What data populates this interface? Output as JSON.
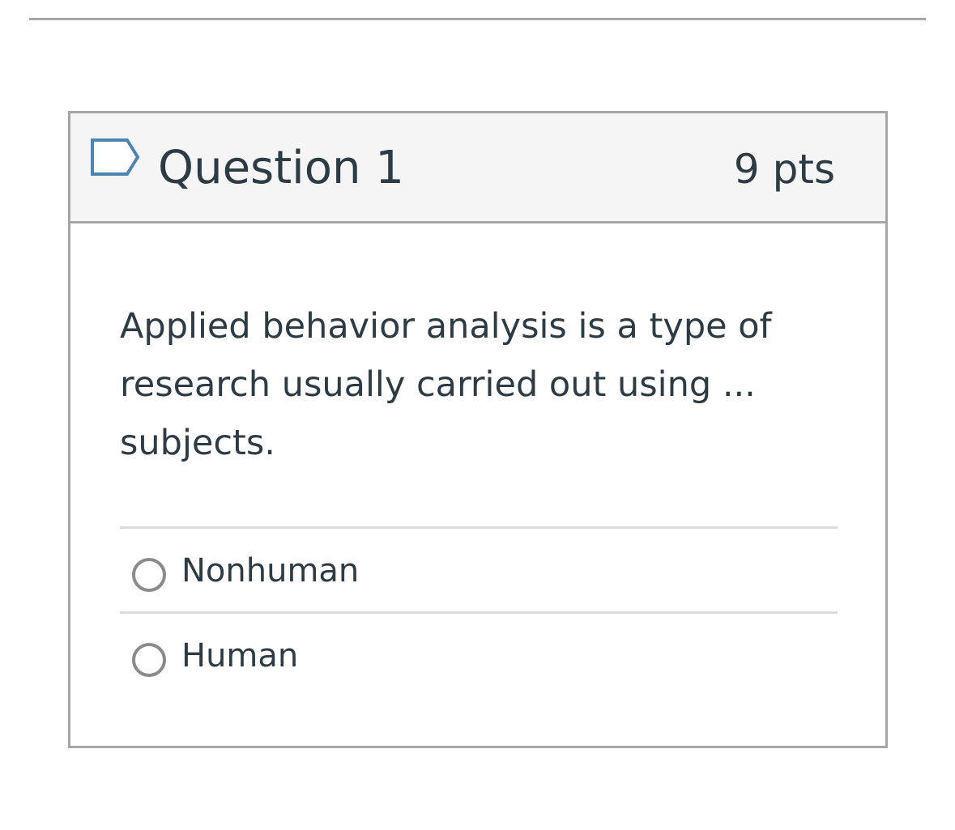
{
  "question": {
    "title": "Question 1",
    "points": "9 pts",
    "flag_icon": "flag-outline-icon",
    "text": "Applied behavior analysis is a type of research usually carried out using ... subjects.",
    "answers": [
      {
        "label": "Nonhuman",
        "selected": false
      },
      {
        "label": "Human",
        "selected": false
      }
    ]
  },
  "colors": {
    "border": "#a6a6a6",
    "header_bg": "#f5f5f5",
    "text": "#2d3b45",
    "flag": "#4e85b0",
    "radio_border": "#8b8b8b",
    "divider": "#dcdcdc"
  }
}
